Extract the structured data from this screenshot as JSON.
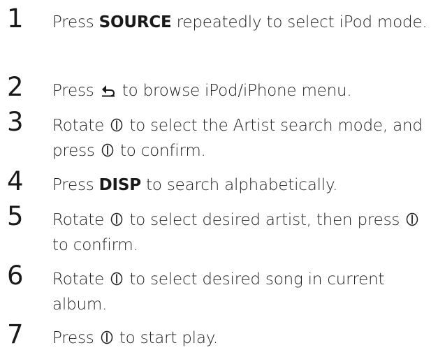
{
  "steps": [
    {
      "number": "1",
      "parts": [
        {
          "t": "text",
          "v": "Press "
        },
        {
          "t": "bold",
          "v": "SOURCE"
        },
        {
          "t": "text",
          "v": " repeatedly to select iPod mode."
        }
      ]
    },
    {
      "number": "2",
      "parts": [
        {
          "t": "text",
          "v": "Press "
        },
        {
          "t": "icon",
          "v": "back-arrow-icon"
        },
        {
          "t": "text",
          "v": " to browse iPod/iPhone menu."
        }
      ]
    },
    {
      "number": "3",
      "parts": [
        {
          "t": "text",
          "v": "Rotate "
        },
        {
          "t": "icon",
          "v": "dial-icon"
        },
        {
          "t": "text",
          "v": " to select the Artist search mode, and press "
        },
        {
          "t": "icon",
          "v": "dial-icon"
        },
        {
          "t": "text",
          "v": " to confirm."
        }
      ]
    },
    {
      "number": "4",
      "parts": [
        {
          "t": "text",
          "v": "Press "
        },
        {
          "t": "bold",
          "v": "DISP"
        },
        {
          "t": "text",
          "v": " to search alphabetically."
        }
      ]
    },
    {
      "number": "5",
      "parts": [
        {
          "t": "text",
          "v": "Rotate "
        },
        {
          "t": "icon",
          "v": "dial-icon"
        },
        {
          "t": "text",
          "v": " to select desired artist, then press "
        },
        {
          "t": "icon",
          "v": "dial-icon"
        },
        {
          "t": "text",
          "v": " to confirm."
        }
      ]
    },
    {
      "number": "6",
      "parts": [
        {
          "t": "text",
          "v": "Rotate "
        },
        {
          "t": "icon",
          "v": "dial-icon"
        },
        {
          "t": "text",
          "v": " to select desired song in current album."
        }
      ]
    },
    {
      "number": "7",
      "parts": [
        {
          "t": "text",
          "v": "Press "
        },
        {
          "t": "icon",
          "v": "dial-icon"
        },
        {
          "t": "text",
          "v": " to start play."
        }
      ]
    }
  ]
}
